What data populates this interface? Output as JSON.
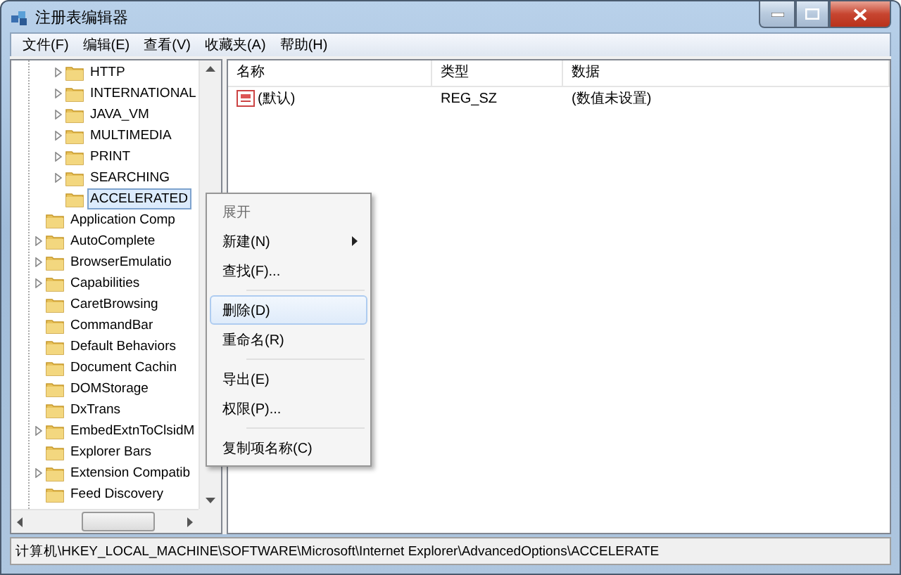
{
  "window": {
    "title": "注册表编辑器"
  },
  "menu_bar": [
    "文件(F)",
    "编辑(E)",
    "查看(V)",
    "收藏夹(A)",
    "帮助(H)"
  ],
  "tree": {
    "inner_items": [
      {
        "label": "HTTP",
        "expandable": true,
        "selected": false
      },
      {
        "label": "INTERNATIONAL",
        "expandable": true,
        "selected": false
      },
      {
        "label": "JAVA_VM",
        "expandable": true,
        "selected": false
      },
      {
        "label": "MULTIMEDIA",
        "expandable": true,
        "selected": false
      },
      {
        "label": "PRINT",
        "expandable": true,
        "selected": false
      },
      {
        "label": "SEARCHING",
        "expandable": true,
        "selected": false
      },
      {
        "label": "ACCELERATED",
        "expandable": false,
        "selected": true
      }
    ],
    "items": [
      {
        "label": "Application Comp",
        "expandable": false,
        "selected": false
      },
      {
        "label": "AutoComplete",
        "expandable": true,
        "selected": false
      },
      {
        "label": "BrowserEmulatio",
        "expandable": true,
        "selected": false
      },
      {
        "label": "Capabilities",
        "expandable": true,
        "selected": false
      },
      {
        "label": "CaretBrowsing",
        "expandable": false,
        "selected": false
      },
      {
        "label": "CommandBar",
        "expandable": false,
        "selected": false
      },
      {
        "label": "Default Behaviors",
        "expandable": false,
        "selected": false
      },
      {
        "label": "Document Cachin",
        "expandable": false,
        "selected": false
      },
      {
        "label": "DOMStorage",
        "expandable": false,
        "selected": false
      },
      {
        "label": "DxTrans",
        "expandable": false,
        "selected": false
      },
      {
        "label": "EmbedExtnToClsidM",
        "expandable": true,
        "selected": false
      },
      {
        "label": "Explorer Bars",
        "expandable": false,
        "selected": false
      },
      {
        "label": "Extension Compatib",
        "expandable": true,
        "selected": false
      },
      {
        "label": "Feed Discovery",
        "expandable": false,
        "selected": false
      }
    ]
  },
  "values": {
    "columns": [
      "名称",
      "类型",
      "数据"
    ],
    "rows": [
      {
        "name": "(默认)",
        "type": "REG_SZ",
        "data": "(数值未设置)"
      }
    ]
  },
  "context_menu": [
    {
      "kind": "item",
      "label": "展开",
      "disabled": true,
      "selected": false,
      "submenu": false
    },
    {
      "kind": "item",
      "label": "新建(N)",
      "disabled": false,
      "selected": false,
      "submenu": true
    },
    {
      "kind": "item",
      "label": "查找(F)...",
      "disabled": false,
      "selected": false,
      "submenu": false
    },
    {
      "kind": "separator"
    },
    {
      "kind": "item",
      "label": "删除(D)",
      "disabled": false,
      "selected": true,
      "submenu": false
    },
    {
      "kind": "item",
      "label": "重命名(R)",
      "disabled": false,
      "selected": false,
      "submenu": false
    },
    {
      "kind": "separator"
    },
    {
      "kind": "item",
      "label": "导出(E)",
      "disabled": false,
      "selected": false,
      "submenu": false
    },
    {
      "kind": "item",
      "label": "权限(P)...",
      "disabled": false,
      "selected": false,
      "submenu": false
    },
    {
      "kind": "separator"
    },
    {
      "kind": "item",
      "label": "复制项名称(C)",
      "disabled": false,
      "selected": false,
      "submenu": false
    }
  ],
  "status_bar": "计算机\\HKEY_LOCAL_MACHINE\\SOFTWARE\\Microsoft\\Internet Explorer\\AdvancedOptions\\ACCELERATE"
}
